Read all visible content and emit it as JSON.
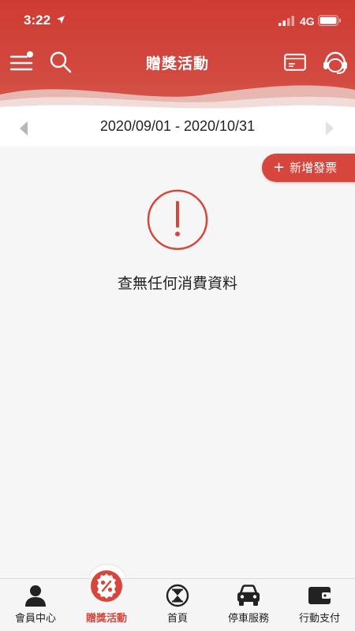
{
  "status_bar": {
    "time": "3:22",
    "network": "4G",
    "icons": [
      "location-arrow-icon",
      "signal-icon",
      "battery-icon"
    ]
  },
  "header": {
    "title": "贈獎活動",
    "icons": [
      "menu-icon",
      "search-icon",
      "card-icon",
      "customer-service-icon"
    ]
  },
  "date_range": {
    "label": "2020/09/01 - 2020/10/31"
  },
  "actions": {
    "add_invoice_label": "新增發票",
    "add_icon": "+"
  },
  "empty_state": {
    "message": "查無任何消費資料",
    "icon": "exclamation-icon"
  },
  "tabbar": {
    "items": [
      {
        "label": "會員中心",
        "icon": "person-icon"
      },
      {
        "label": "贈獎活動",
        "icon": "percent-badge-icon",
        "active": true
      },
      {
        "label": "首頁",
        "icon": "hourglass-icon"
      },
      {
        "label": "停車服務",
        "icon": "car-icon"
      },
      {
        "label": "行動支付",
        "icon": "wallet-icon"
      }
    ]
  },
  "colors": {
    "brand_red": "#d6463c",
    "background": "#f6f6f6"
  }
}
